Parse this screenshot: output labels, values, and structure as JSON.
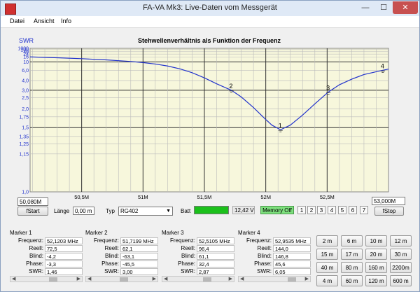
{
  "window": {
    "title": "FA-VA Mk3:     Live-Daten vom Messgerät",
    "minimize": "—",
    "maximize": "☐",
    "close": "✕"
  },
  "menu": [
    "Datei",
    "Ansicht",
    "Info"
  ],
  "chart_data": {
    "type": "line",
    "title": "Stehwellenverhältnis als Funktion der Frequenz",
    "ylabel": "SWR",
    "xlabel": "",
    "x_unit": "Hz",
    "xlim": [
      50080000,
      53000000
    ],
    "ylim": [
      1.0,
      1000
    ],
    "y_scale": "reflection-mapped",
    "x_ticks": [
      {
        "value": 50500000,
        "label": "50,5M"
      },
      {
        "value": 51000000,
        "label": "51M"
      },
      {
        "value": 51500000,
        "label": "51,5M"
      },
      {
        "value": 52000000,
        "label": "52M"
      },
      {
        "value": 52500000,
        "label": "52,5M"
      }
    ],
    "y_ticks": [
      {
        "value": 1000,
        "label": "1000"
      },
      {
        "value": 100,
        "label": "100"
      },
      {
        "value": 40,
        "label": "40"
      },
      {
        "value": 24,
        "label": "24"
      },
      {
        "value": 16,
        "label": "16"
      },
      {
        "value": 10,
        "label": "10"
      },
      {
        "value": 6.0,
        "label": "6,0"
      },
      {
        "value": 4.0,
        "label": "4,0"
      },
      {
        "value": 3.0,
        "label": "3,0"
      },
      {
        "value": 2.5,
        "label": "2,5"
      },
      {
        "value": 2.0,
        "label": "2,0"
      },
      {
        "value": 1.75,
        "label": "1,75"
      },
      {
        "value": 1.5,
        "label": "1,5"
      },
      {
        "value": 1.35,
        "label": "1,35"
      },
      {
        "value": 1.25,
        "label": "1,25"
      },
      {
        "value": 1.15,
        "label": "1,15"
      },
      {
        "value": 1.0,
        "label": "1,0"
      }
    ],
    "grid": true,
    "series": [
      {
        "color": "#2233cc",
        "x": [
          50080000,
          50300000,
          50500000,
          50700000,
          50900000,
          51000000,
          51100000,
          51200000,
          51300000,
          51400000,
          51500000,
          51600000,
          51719900,
          51800000,
          51900000,
          52000000,
          52050000,
          52120300,
          52200000,
          52300000,
          52400000,
          52510500,
          52600000,
          52700000,
          52800000,
          52953500,
          53000000
        ],
        "y": [
          16,
          14.5,
          13.2,
          11.8,
          10.3,
          9.5,
          8.6,
          7.6,
          6.5,
          5.4,
          4.4,
          3.6,
          3.0,
          2.55,
          2.05,
          1.68,
          1.55,
          1.46,
          1.55,
          1.8,
          2.2,
          2.87,
          3.5,
          4.2,
          5.0,
          6.05,
          6.4
        ]
      }
    ],
    "markers": [
      {
        "label": "1",
        "x": 52120300,
        "y": 1.46
      },
      {
        "label": "2",
        "x": 51719900,
        "y": 3.0
      },
      {
        "label": "3",
        "x": 52510500,
        "y": 2.87
      },
      {
        "label": "4",
        "x": 52953500,
        "y": 6.05
      }
    ]
  },
  "controls": {
    "fstart_value": "50,080M",
    "fstart_button": "fStart",
    "length_label": "Länge",
    "length_value": "0,00 m",
    "type_label": "Typ",
    "type_value": "RG402",
    "batt_label": "Batt",
    "batt_level": 1.0,
    "batt_voltage": "12,42 V",
    "memory_button": "Memory Off",
    "memory_slots": [
      "1",
      "2",
      "3",
      "4",
      "5",
      "6",
      "7"
    ],
    "fstop_value": "53,000M",
    "fstop_button": "fStop"
  },
  "marker_labels": {
    "freq": "Frequenz:",
    "real": "Reell:",
    "imag": "Blind:",
    "phase": "Phase:",
    "swr": "SWR:"
  },
  "markers": [
    {
      "title": "Marker 1",
      "freq": "52,1203 MHz",
      "real": "72,5",
      "imag": "-4,2",
      "phase": "-3,3",
      "swr": "1,46"
    },
    {
      "title": "Marker 2",
      "freq": "51,7199 MHz",
      "real": "62,1",
      "imag": "-63,1",
      "phase": "-45,5",
      "swr": "3,00"
    },
    {
      "title": "Marker 3",
      "freq": "52,5105 MHz",
      "real": "96,4",
      "imag": "61,1",
      "phase": "32,4",
      "swr": "2,87"
    },
    {
      "title": "Marker 4",
      "freq": "52,9535 MHz",
      "real": "144,0",
      "imag": "146,8",
      "phase": "45,6",
      "swr": "6,05"
    }
  ],
  "span_buttons": [
    "2 m",
    "6 m",
    "10 m",
    "12 m",
    "15 m",
    "17 m",
    "20 m",
    "30 m",
    "40 m",
    "80 m",
    "160 m",
    "2200m",
    "4 m",
    "60 m",
    "120 m",
    "600 m"
  ]
}
